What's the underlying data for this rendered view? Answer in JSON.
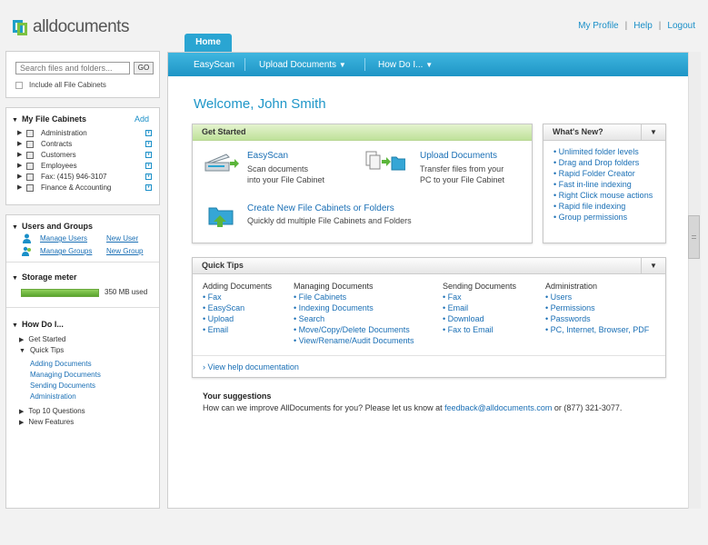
{
  "header": {
    "logo_text": "alldocuments",
    "links": [
      "My Profile",
      "Help",
      "Logout"
    ]
  },
  "search": {
    "placeholder": "Search files and folders...",
    "go_label": "GO",
    "include_all_label": "Include all File Cabinets"
  },
  "cabinets": {
    "title": "My File Cabinets",
    "add_label": "Add",
    "items": [
      "Administration",
      "Contracts",
      "Customers",
      "Employees",
      "Fax: (415) 946-3107",
      "Finance & Accounting"
    ]
  },
  "users": {
    "title": "Users and Groups",
    "manage_users": "Manage Users",
    "new_user": "New User",
    "manage_groups": "Manage Groups",
    "new_group": "New Group"
  },
  "storage": {
    "title": "Storage meter",
    "value": "350 MB used",
    "fill_fraction": 1.0
  },
  "howdo": {
    "title": "How Do I...",
    "items": {
      "get_started": "Get Started",
      "quick_tips": "Quick Tips",
      "sub": [
        "Adding Documents",
        "Managing Documents",
        "Sending Documents",
        "Administration"
      ],
      "top10": "Top 10 Questions",
      "new_features": "New Features"
    }
  },
  "tabs": {
    "home": "Home"
  },
  "nav": {
    "items": [
      "EasyScan",
      "Upload Documents",
      "How Do I..."
    ]
  },
  "main": {
    "welcome": "Welcome, John Smith",
    "get_started": {
      "title": "Get Started",
      "easyscan_title": "EasyScan",
      "easyscan_desc1": "Scan documents",
      "easyscan_desc2": "into your File Cabinet",
      "upload_title": "Upload Documents",
      "upload_desc1": "Transfer files from your",
      "upload_desc2": "PC to your File Cabinet",
      "create_title": "Create New File Cabinets  or Folders",
      "create_desc": "Quickly dd multiple File Cabinets and Folders"
    },
    "whats_new": {
      "title": "What's New?",
      "items": [
        "Unlimited folder levels",
        "Drag and Drop folders",
        "Rapid Folder Creator",
        "Fast in-line indexing",
        "Right Click mouse actions",
        "Rapid file indexing",
        "Group permissions"
      ]
    },
    "quick_tips": {
      "title": "Quick Tips",
      "columns": [
        {
          "heading": "Adding Documents",
          "items": [
            "Fax",
            "EasyScan",
            "Upload",
            "Email"
          ]
        },
        {
          "heading": "Managing Documents",
          "items": [
            "File Cabinets",
            "Indexing Documents",
            "Search",
            "Move/Copy/Delete Documents",
            "View/Rename/Audit Documents"
          ]
        },
        {
          "heading": "Sending Documents",
          "items": [
            "Fax",
            "Email",
            "Download",
            "Fax to Email"
          ]
        },
        {
          "heading": "Administration",
          "items": [
            "Users",
            "Permissions",
            "Passwords",
            "PC, Internet, Browser, PDF"
          ]
        }
      ],
      "help_link": "View help documentation"
    },
    "suggestions": {
      "title": "Your suggestions",
      "text_before": "How can we improve AllDocuments for you? Please let us know at ",
      "email": "feedback@alldocuments.com",
      "text_after": " or (877) 321-3077."
    }
  },
  "colors": {
    "accent": "#1e96c8",
    "nav": "#2aa5d2",
    "green": "#7cc242",
    "link": "#1a6fb5"
  }
}
